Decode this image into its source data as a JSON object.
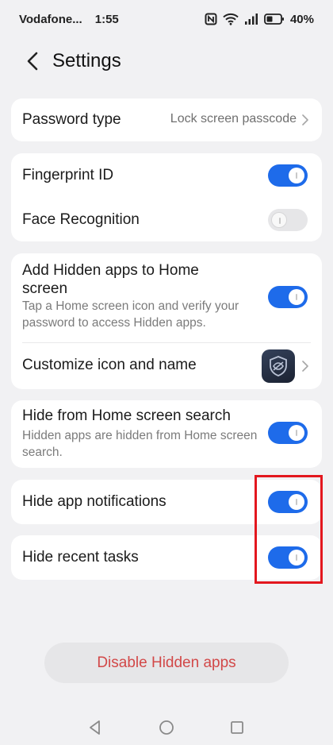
{
  "status_bar": {
    "carrier": "Vodafone...",
    "time": "1:55",
    "battery": "40%",
    "icons": [
      "nfc-icon",
      "wifi-icon",
      "signal-icon",
      "battery-icon"
    ]
  },
  "header": {
    "title": "Settings",
    "back_icon": "back-arrow-icon"
  },
  "password": {
    "title": "Password type",
    "value": "Lock screen passcode"
  },
  "biometrics": {
    "fingerprint": {
      "title": "Fingerprint ID",
      "enabled": true
    },
    "face": {
      "title": "Face Recognition",
      "enabled": false
    }
  },
  "hidden_apps": {
    "add_home": {
      "title": "Add Hidden apps to Home screen",
      "subtitle": "Tap a Home screen icon and verify your password to access Hidden apps.",
      "enabled": true
    },
    "customize": {
      "title": "Customize icon and name",
      "icon": "hidden-apps-shield-icon"
    }
  },
  "search": {
    "title": "Hide from Home screen search",
    "subtitle": "Hidden apps are hidden from Home screen search.",
    "enabled": true
  },
  "notifications": {
    "title": "Hide app notifications",
    "enabled": true
  },
  "recent": {
    "title": "Hide recent tasks",
    "enabled": true
  },
  "disable_button": "Disable Hidden apps",
  "colors": {
    "accent": "#1e6bea",
    "danger_text": "#d24848",
    "highlight": "#e3171e",
    "background": "#f1f1f3"
  }
}
